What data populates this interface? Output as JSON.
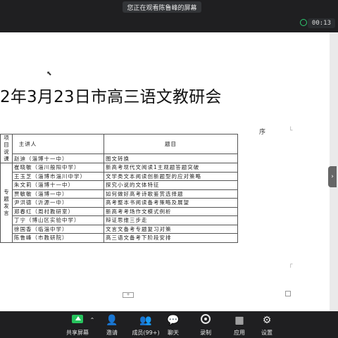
{
  "meeting": {
    "share_banner": "您正在观看陈鲁峰的屏幕",
    "timer": "00:13"
  },
  "document": {
    "title": "2年3月23日市高三语文教研会",
    "heading_tail": "序",
    "table": {
      "header": {
        "category": "项目说课",
        "speaker": "主讲人",
        "topic": "题目"
      },
      "first_row": {
        "speaker": "赵迪（淄博十一中）",
        "topic": "图文转换"
      },
      "group_label": "专题发言",
      "rows": [
        {
          "speaker": "崔晓敏（淄川般阳中学）",
          "topic": "新高考现代文阅读1主观题答题突破"
        },
        {
          "speaker": "王玉芝（淄博市淄川中学）",
          "topic": "文学类文本阅读创新题型的应对策略"
        },
        {
          "speaker": "朱文莉（淄博十一中）",
          "topic": "探究小说的文体特征"
        },
        {
          "speaker": "贾敏敏（淄博一中）",
          "topic": "如何做好高考诗歌鉴赏选择题"
        },
        {
          "speaker": "尹洪德（沂源一中）",
          "topic": "高考整本书阅读备考策略及展望"
        },
        {
          "speaker": "郑春红（周村教研室）",
          "topic": "新高考考场作文模式例析"
        },
        {
          "speaker": "丁宁（博山区实验中学）",
          "topic": "辩证思维三步走"
        },
        {
          "speaker": "徐国香（临淄中学）",
          "topic": "文言文备考专题复习对策"
        },
        {
          "speaker": "陈鲁峰（市教研院）",
          "topic": "高三语文备考下阶段安排"
        }
      ]
    }
  },
  "toolbar": {
    "share_label": "共享屏幕",
    "invite_label": "邀请",
    "members_label": "成员(99+)",
    "chat_label": "聊天",
    "record_label": "录制",
    "apps_label": "应用",
    "settings_label": "设置",
    "accent_color": "#27c35d"
  }
}
